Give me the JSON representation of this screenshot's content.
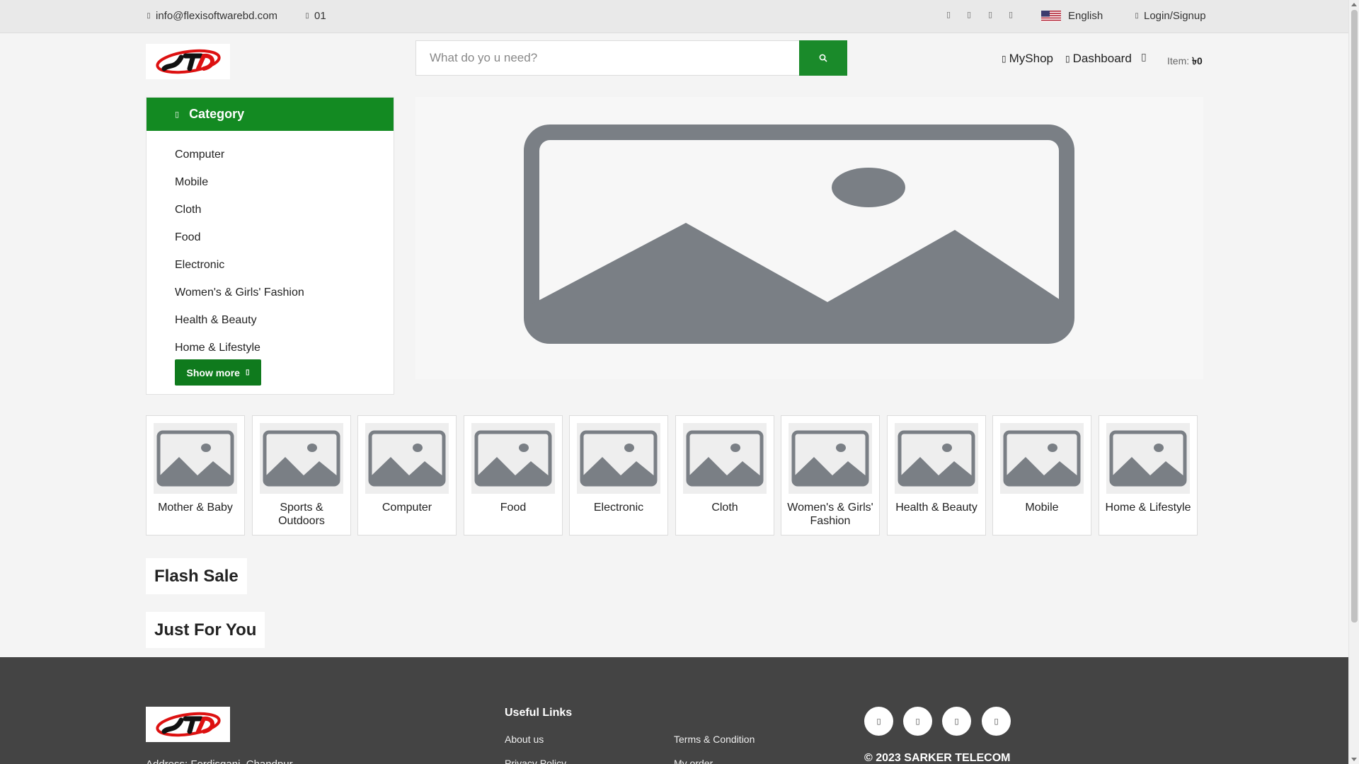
{
  "topbar": {
    "email": "info@flexisoftwarebd.com",
    "phone": "01",
    "language": "English",
    "login": "Login/Signup",
    "social_icons": [
      "facebook-icon",
      "twitter-icon",
      "instagram-icon",
      "youtube-icon"
    ]
  },
  "header": {
    "search_placeholder": "What do yo u need?",
    "myshop": "MyShop",
    "dashboard": "Dashboard",
    "items_label": "Item:",
    "items_total": "৳0"
  },
  "category": {
    "title": "Category",
    "items": [
      "Computer",
      "Mobile",
      "Cloth",
      "Food",
      "Electronic",
      "Women's & Girls' Fashion",
      "Health & Beauty",
      "Home & Lifestyle"
    ],
    "show_more": "Show more"
  },
  "cards": [
    "Mother & Baby",
    "Sports & Outdoors",
    "Computer",
    "Food",
    "Electronic",
    "Cloth",
    "Women's & Girls' Fashion",
    "Health & Beauty",
    "Mobile",
    "Home & Lifestyle"
  ],
  "sections": {
    "flash_sale": "Flash Sale",
    "just_for_you": "Just For You"
  },
  "footer": {
    "address": "Address: Fordisganj, Chandpur",
    "useful_links_title": "Useful Links",
    "links_col1": [
      "About us",
      "Privacy Policy"
    ],
    "links_col2": [
      "Terms & Condition",
      "My order"
    ],
    "social_icons": [
      "facebook-icon",
      "twitter-icon",
      "instagram-icon",
      "youtube-icon"
    ],
    "copyright": "© 2023 SARKER TELECOM"
  },
  "colors": {
    "primary_green": "#138a22",
    "footer_bg": "#444444",
    "placeholder_gray": "#7a7f85"
  }
}
